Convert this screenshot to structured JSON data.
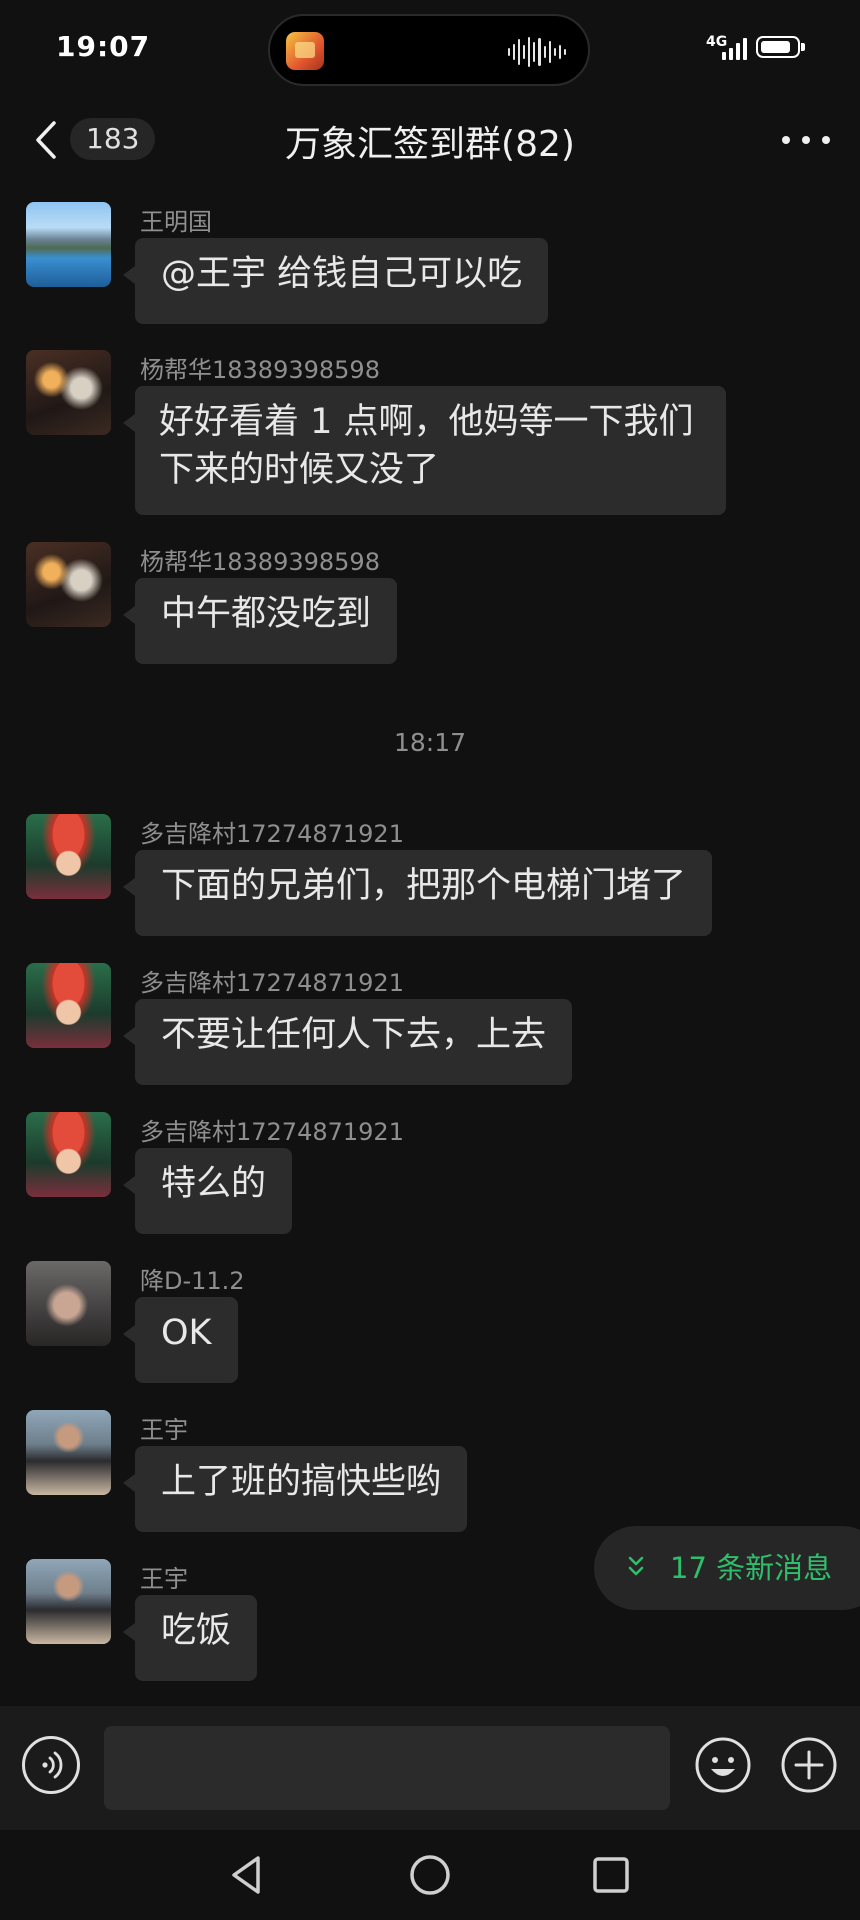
{
  "status_bar": {
    "time": "19:07",
    "network": "4G",
    "battery_level": 0.85
  },
  "header": {
    "back_icon": "chevron-left-icon",
    "unread_count": "183",
    "title": "万象汇签到群(82)",
    "more_icon": "more-horizontal-icon"
  },
  "messages": [
    {
      "sender": "王明国",
      "text": "@王宇  给钱自己可以吃",
      "avatar": "landscape-avatar"
    },
    {
      "sender": "杨帮华18389398598",
      "text": "好好看着 1 点啊，他妈等一下我们下来的时候又没了",
      "avatar": "person-avatar"
    },
    {
      "sender": "杨帮华18389398598",
      "text": "中午都没吃到",
      "avatar": "person-avatar"
    },
    {
      "sender": "多吉降村17274871921",
      "text": "下面的兄弟们，把那个电梯门堵了",
      "avatar": "person-avatar"
    },
    {
      "sender": "多吉降村17274871921",
      "text": "不要让任何人下去，上去",
      "avatar": "person-avatar"
    },
    {
      "sender": "多吉降村17274871921",
      "text": "特么的",
      "avatar": "person-avatar"
    },
    {
      "sender": "降D-11.2",
      "text": "OK",
      "avatar": "person-avatar"
    },
    {
      "sender": "王宇",
      "text": "上了班的搞快些哟",
      "avatar": "person-avatar"
    },
    {
      "sender": "王宇",
      "text": "吃饭",
      "avatar": "person-avatar"
    }
  ],
  "timestamp": "18:17",
  "new_messages": {
    "label": "17 条新消息",
    "icon": "double-chevron-down-icon",
    "color": "#2fbf6b"
  },
  "input_bar": {
    "value": "",
    "voice_icon": "voice-icon",
    "emoji_icon": "emoji-icon",
    "plus_icon": "plus-icon"
  },
  "system_nav": {
    "back_icon": "triangle-back-icon",
    "home_icon": "circle-home-icon",
    "recents_icon": "square-recents-icon"
  }
}
